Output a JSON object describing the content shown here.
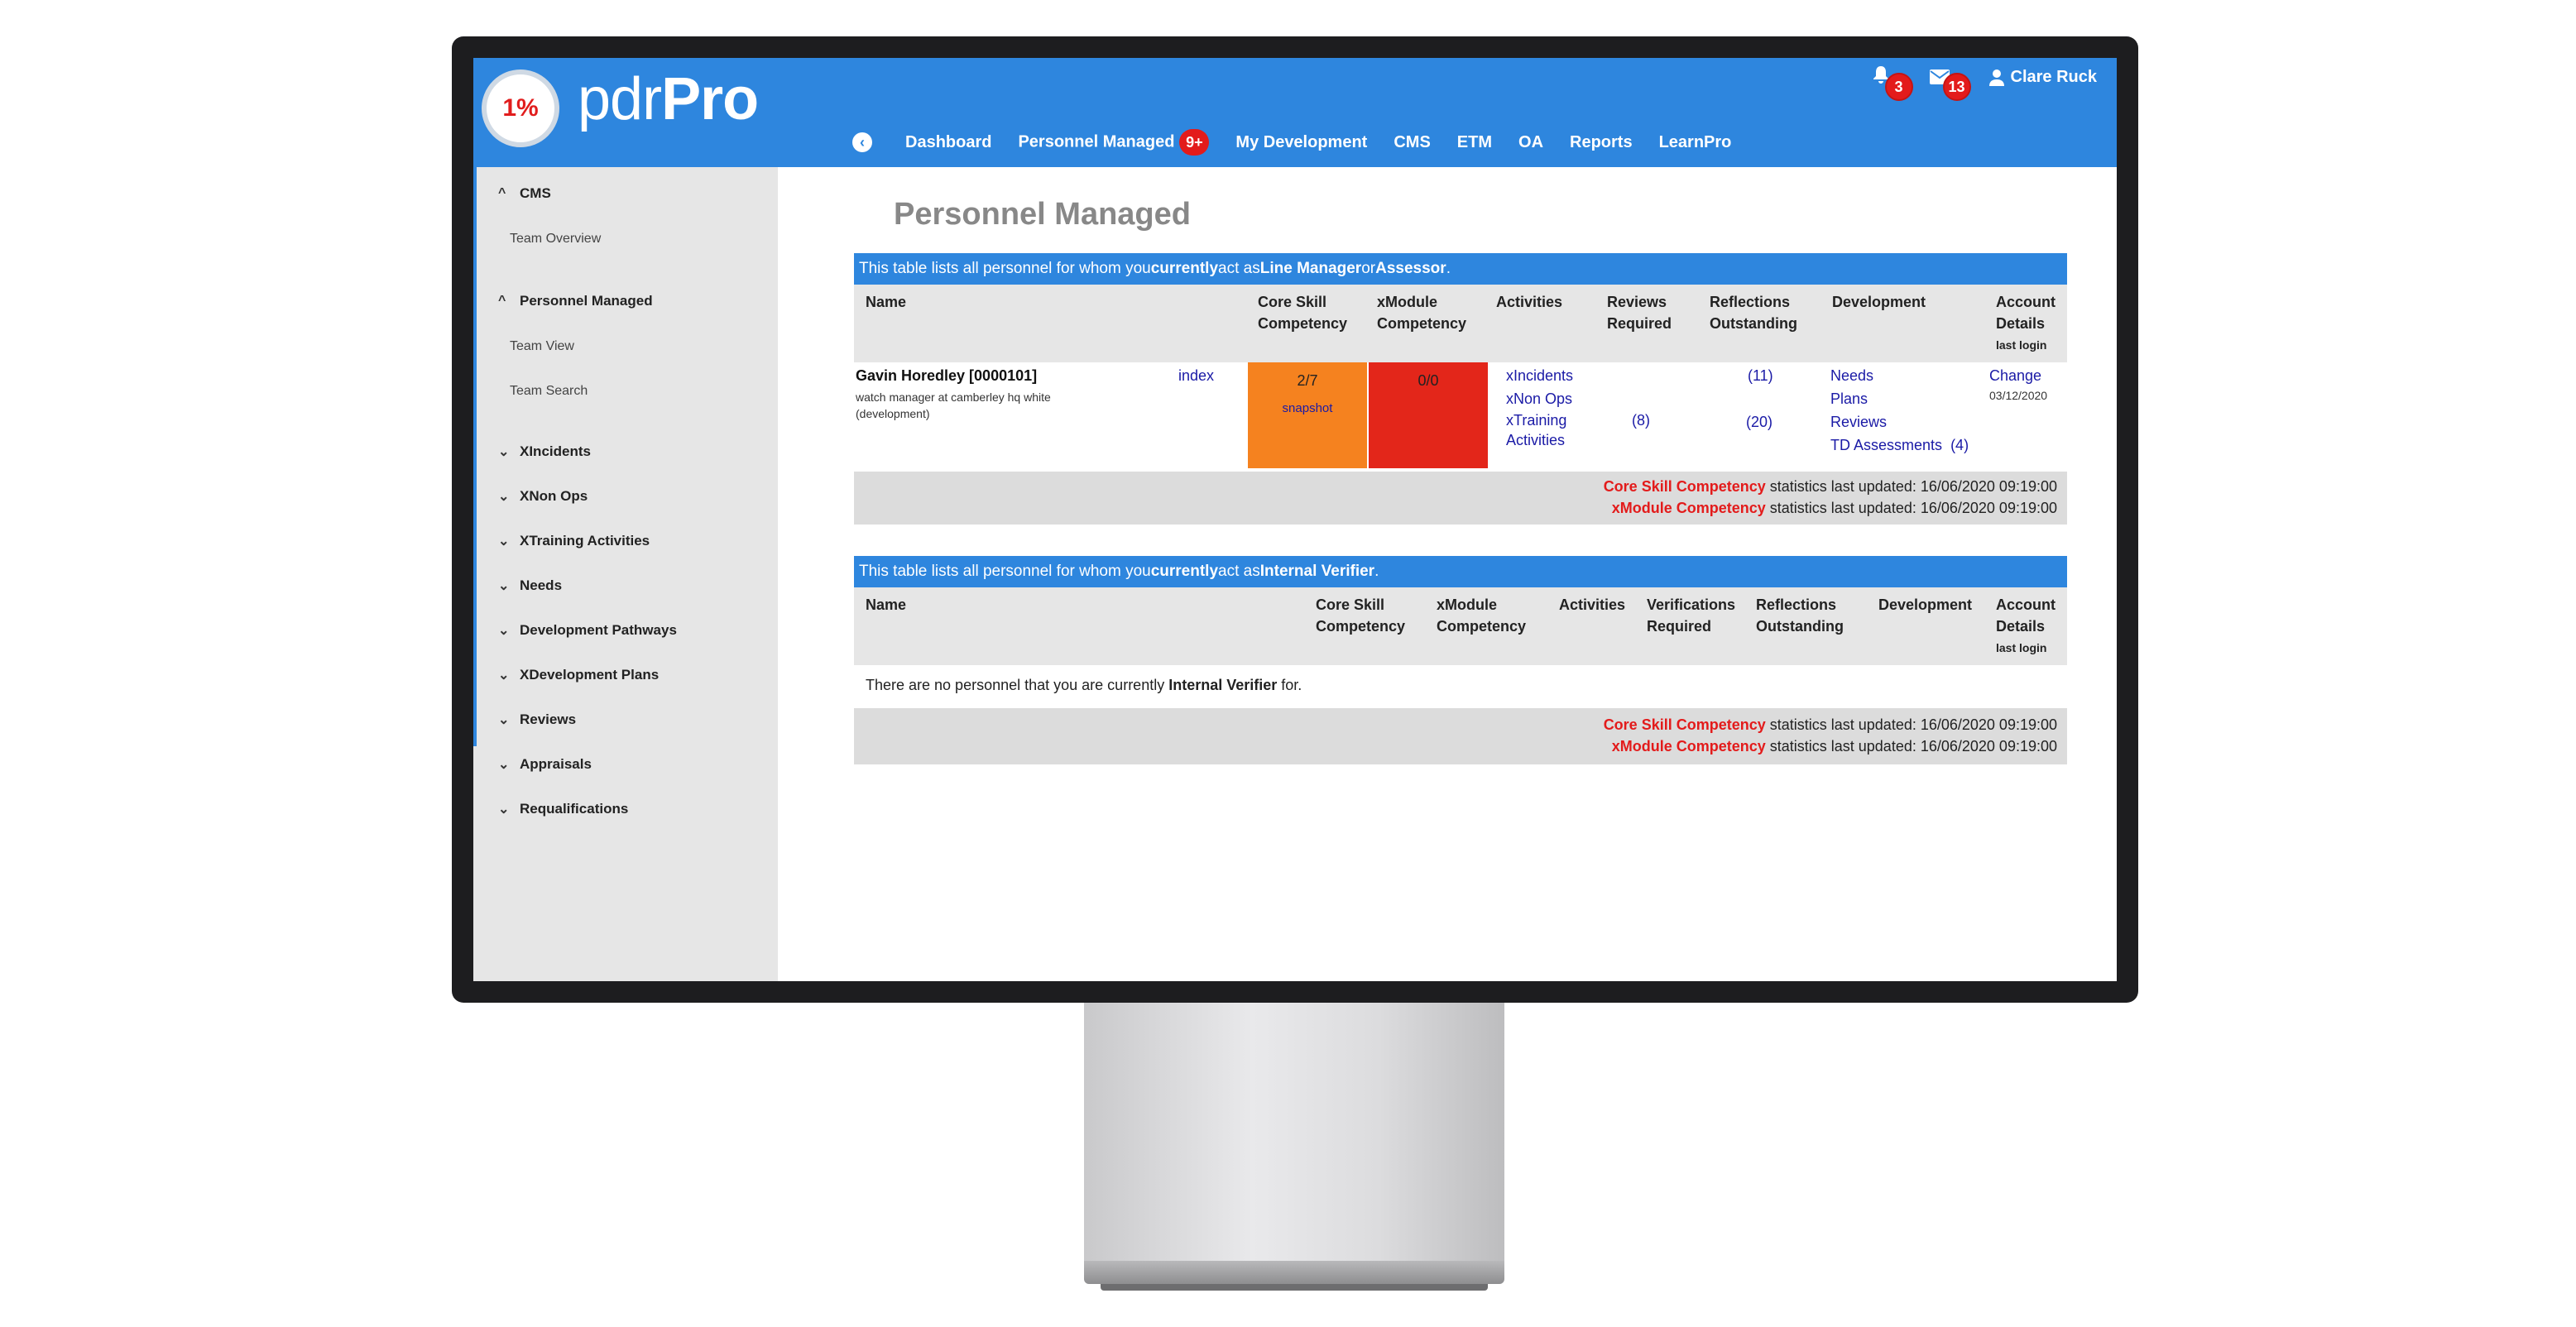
{
  "header": {
    "logo_percent": "1%",
    "logo_text_light": "pdr",
    "logo_text_bold": "Pro",
    "notifications_count": "3",
    "messages_count": "13",
    "user_name": "Clare Ruck"
  },
  "nav": {
    "items": [
      "Dashboard",
      "Personnel Managed",
      "My Development",
      "CMS",
      "ETM",
      "OA",
      "Reports",
      "LearnPro"
    ],
    "personnel_badge": "9+"
  },
  "sidebar": {
    "groups": [
      {
        "label": "CMS",
        "subs": [
          "Team Overview"
        ]
      },
      {
        "label": "Personnel Managed",
        "subs": [
          "Team View",
          "Team Search"
        ]
      },
      {
        "label": "XIncidents"
      },
      {
        "label": "XNon Ops"
      },
      {
        "label": "XTraining Activities"
      },
      {
        "label": "Needs"
      },
      {
        "label": "Development Pathways"
      },
      {
        "label": "XDevelopment Plans"
      },
      {
        "label": "Reviews"
      },
      {
        "label": "Appraisals"
      },
      {
        "label": "Requalifications"
      }
    ]
  },
  "page_title": "Personnel Managed",
  "table1": {
    "head_pre": "This table lists all personnel for whom you ",
    "head_bold": "currently",
    "head_mid": " act as ",
    "head_role": "Line Manager",
    "head_or": " or ",
    "head_role2": "Assessor",
    "head_end": ".",
    "columns": {
      "name": "Name",
      "core_skill": "Core Skill Competency",
      "xmodule": "xModule Competency",
      "activities": "Activities",
      "reviews": "Reviews Required",
      "reflections": "Reflections Outstanding",
      "development": "Development",
      "account": "Account Details",
      "last_login": "last login"
    },
    "row": {
      "name": "Gavin Horedley [0000101]",
      "role": "watch manager at camberley hq white (development)",
      "index_link": "index",
      "core_skill": "2/7",
      "core_snapshot": "snapshot",
      "xmodule": "0/0",
      "activities": [
        "xIncidents",
        "xNon Ops",
        "xTraining Activities"
      ],
      "reviews": "(8)",
      "reflections_1": "(11)",
      "reflections_2": "(20)",
      "development": [
        "Needs",
        "Plans",
        "Reviews",
        "TD Assessments"
      ],
      "td_count": "(4)",
      "account_link": "Change",
      "last_login": "03/12/2020"
    },
    "footer_core": "Core Skill Competency",
    "footer_xmodule": "xModule Competency",
    "footer_text": " statistics last updated: 16/06/2020 09:19:00"
  },
  "table2": {
    "head_pre": "This table lists all personnel for whom you ",
    "head_bold": "currently",
    "head_mid": " act as ",
    "head_role": "Internal Verifier",
    "head_end": ".",
    "columns": {
      "name": "Name",
      "core_skill": "Core Skill Competency",
      "xmodule": "xModule Competency",
      "activities": "Activities",
      "verifications": "Verifications Required",
      "reflections": "Reflections Outstanding",
      "development": "Development",
      "account": "Account Details",
      "last_login": "last login"
    },
    "empty_pre": "There are no personnel that you are currently ",
    "empty_bold": "Internal Verifier",
    "empty_end": " for.",
    "footer_core": "Core Skill Competency",
    "footer_xmodule": "xModule Competency",
    "footer_text": " statistics last updated: 16/06/2020 09:19:00"
  },
  "colors": {
    "brand_blue": "#2e86de",
    "core_orange": "#f5821f",
    "xmodule_red": "#e3261a",
    "badge_red": "#e31b1b"
  }
}
